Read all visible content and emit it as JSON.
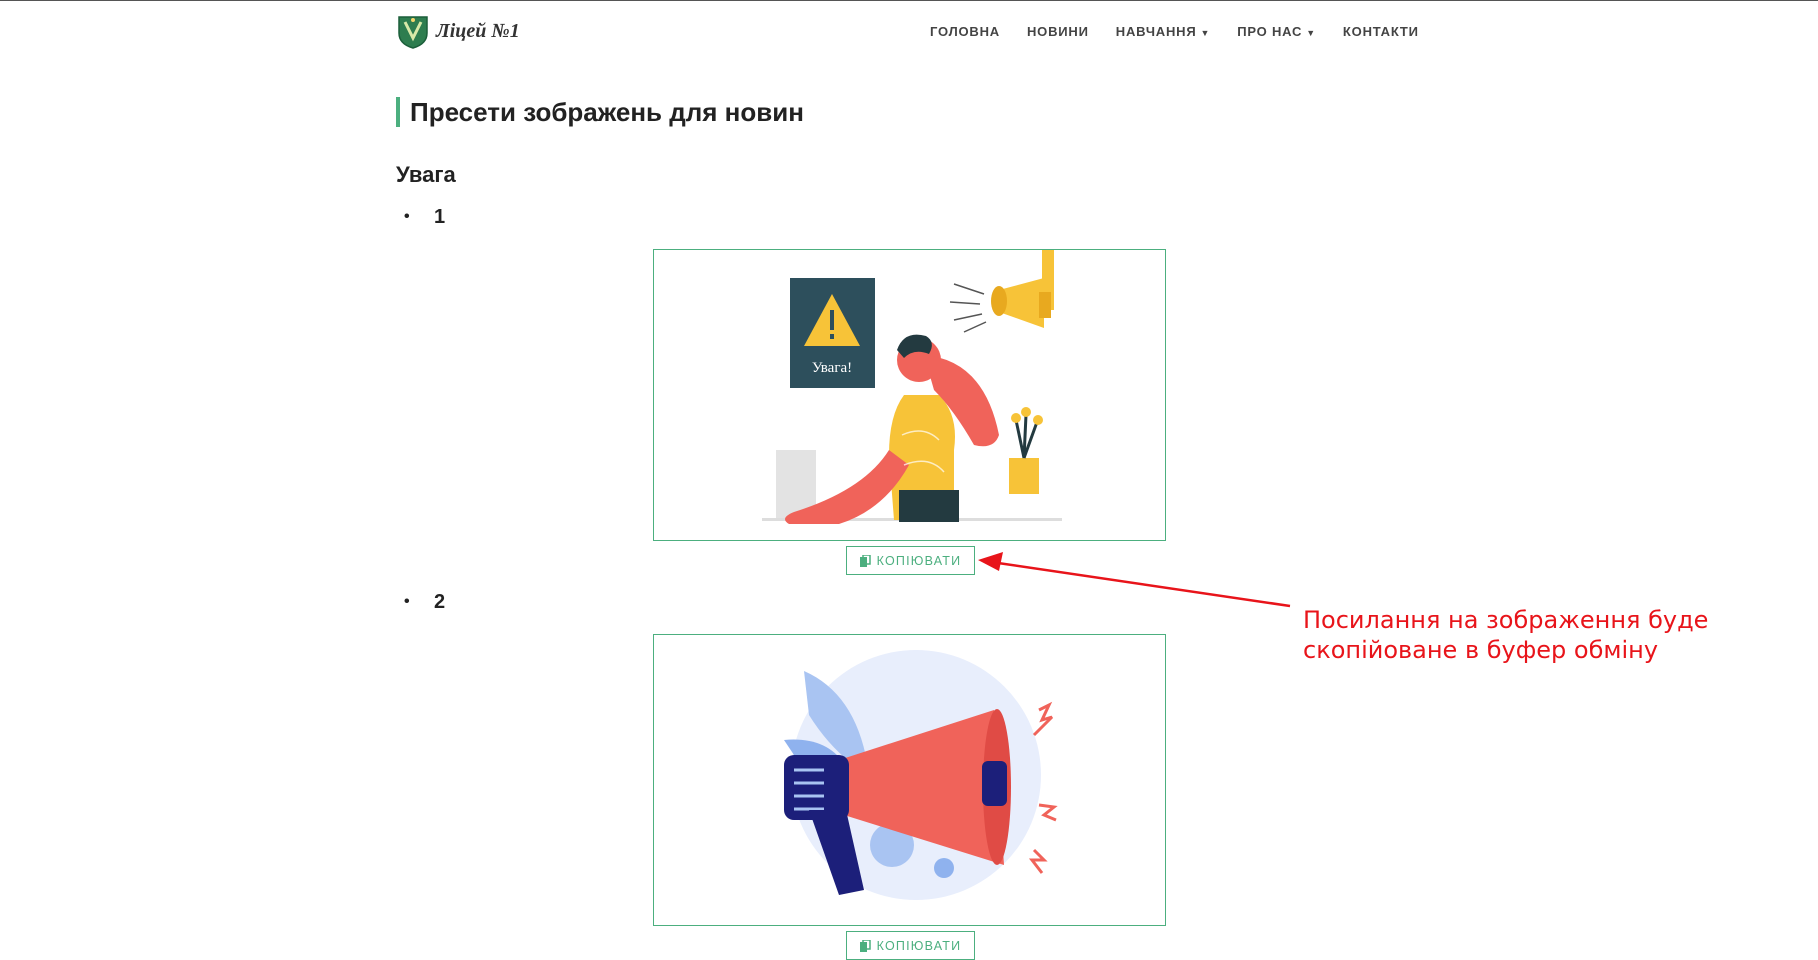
{
  "header": {
    "logo_text": "Ліцей №1",
    "nav": [
      {
        "label": "ГОЛОВНА",
        "dropdown": false
      },
      {
        "label": "НОВИНИ",
        "dropdown": false
      },
      {
        "label": "НАВЧАННЯ",
        "dropdown": true
      },
      {
        "label": "ПРО НАС",
        "dropdown": true
      },
      {
        "label": "КОНТАКТИ",
        "dropdown": false
      }
    ]
  },
  "page": {
    "title": "Пресети зображень для новин",
    "section": "Увага",
    "items": [
      {
        "number": "1",
        "image_text": "Увага!",
        "copy_label": "КОПІЮВАТИ"
      },
      {
        "number": "2",
        "copy_label": "КОПІЮВАТИ"
      }
    ]
  },
  "annotation": {
    "line1": "Посилання на зображення буде",
    "line2": "скопійоване в буфер обміну"
  },
  "colors": {
    "accent": "#4caf7f",
    "annotation": "#e8141a",
    "coral": "#f0635a",
    "yellow": "#f7c338",
    "navy": "#1c1f7a"
  }
}
